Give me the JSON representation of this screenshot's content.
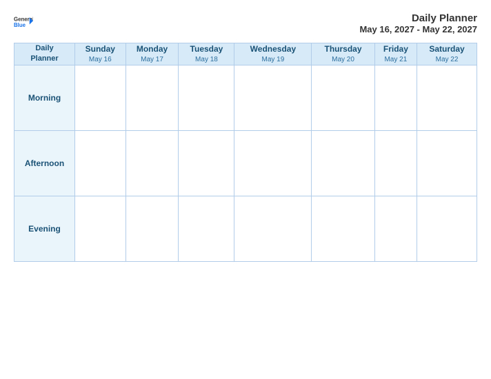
{
  "header": {
    "logo_general": "General",
    "logo_blue": "Blue",
    "title": "Daily Planner",
    "date_range": "May 16, 2027 - May 22, 2027"
  },
  "table": {
    "first_col_header_line1": "Daily",
    "first_col_header_line2": "Planner",
    "columns": [
      {
        "day": "Sunday",
        "date": "May 16"
      },
      {
        "day": "Monday",
        "date": "May 17"
      },
      {
        "day": "Tuesday",
        "date": "May 18"
      },
      {
        "day": "Wednesday",
        "date": "May 19"
      },
      {
        "day": "Thursday",
        "date": "May 20"
      },
      {
        "day": "Friday",
        "date": "May 21"
      },
      {
        "day": "Saturday",
        "date": "May 22"
      }
    ],
    "rows": [
      {
        "label": "Morning"
      },
      {
        "label": "Afternoon"
      },
      {
        "label": "Evening"
      }
    ]
  },
  "colors": {
    "accent": "#1a73e8",
    "header_bg": "#d6eaf8",
    "row_label_bg": "#eaf4fb",
    "border": "#4a90d9",
    "text_dark": "#1a5276"
  }
}
